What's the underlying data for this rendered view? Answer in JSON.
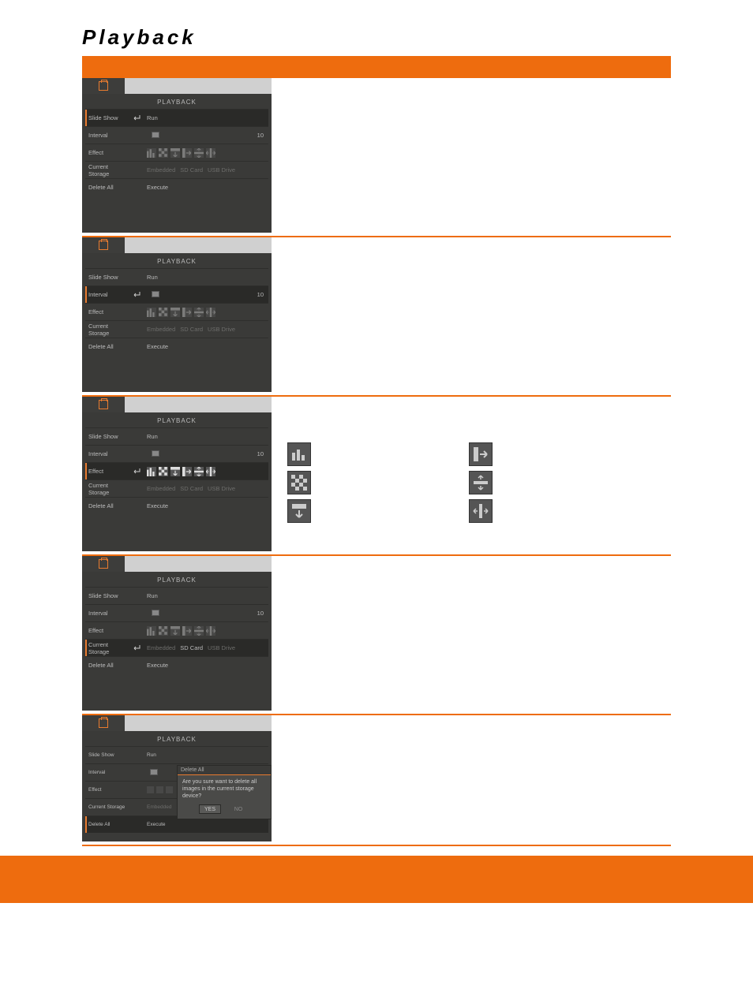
{
  "page_title": "Playback",
  "menu_title": "PLAYBACK",
  "rows": {
    "slide_show": "Slide Show",
    "interval": "Interval",
    "effect": "Effect",
    "current_storage": "Current Storage",
    "delete_all": "Delete All"
  },
  "values": {
    "run": "Run",
    "interval_val": "10",
    "embedded": "Embedded",
    "sd_card": "SD Card",
    "usb_drive": "USB Drive",
    "execute": "Execute"
  },
  "effect_icons": {
    "bars": "bars-transition-icon",
    "checker": "checker-transition-icon",
    "down": "down-transition-icon",
    "right": "slide-right-transition-icon",
    "split_h": "split-horizontal-transition-icon",
    "split_v": "split-vertical-transition-icon"
  },
  "dialog": {
    "title": "Delete All",
    "body": "Are you sure want to delete all images in the current storage device?",
    "yes": "YES",
    "no": "NO"
  }
}
